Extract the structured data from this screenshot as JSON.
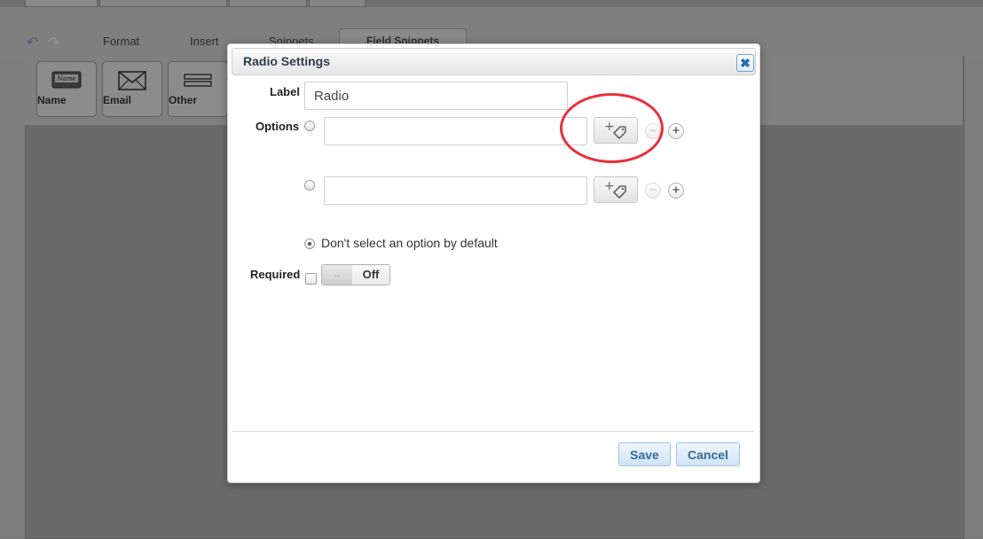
{
  "toolbar": {
    "menu": [
      "Format",
      "Insert",
      "Snippets"
    ],
    "field_snippets_tab": "Field Snippets"
  },
  "snippet_buttons": [
    {
      "label": "Name",
      "icon": "name-card-icon"
    },
    {
      "label": "Email",
      "icon": "envelope-icon"
    },
    {
      "label": "Other",
      "icon": "field-other-icon"
    }
  ],
  "dialog": {
    "title": "Radio Settings",
    "close_icon": "close-icon",
    "label_caption": "Label",
    "label_value": "Radio",
    "options_caption": "Options",
    "options": [
      {
        "value": "",
        "selected": false
      },
      {
        "value": "",
        "selected": false
      }
    ],
    "add_tag_icon": "add-tag-icon",
    "default_option_label": "Don't select an option by default",
    "default_option_selected": true,
    "required_caption": "Required",
    "required_checked": false,
    "toggle_state": "Off",
    "save_label": "Save",
    "cancel_label": "Cancel"
  },
  "colors": {
    "accent": "#336a9c",
    "highlight": "#e8303a",
    "overlay": "#7d7d7d"
  }
}
